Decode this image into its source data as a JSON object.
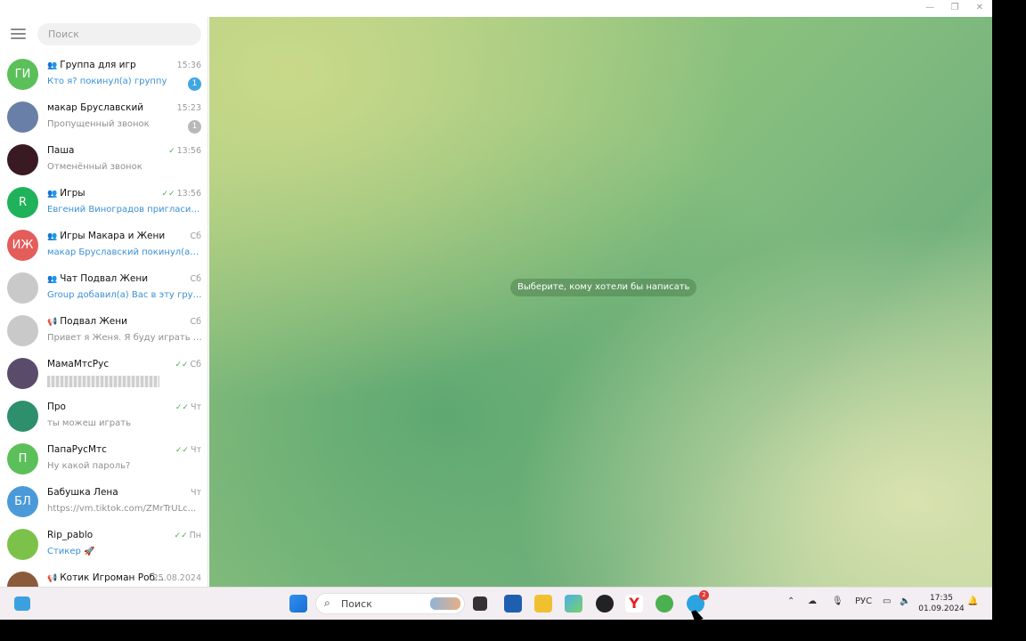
{
  "sidebar": {
    "search_placeholder": "Поиск",
    "chats": [
      {
        "name": "Группа для игр",
        "group": true,
        "channel": false,
        "time": "15:36",
        "preview": "Кто я? покинул(а) группу",
        "preview_blue": true,
        "initials": "ГИ",
        "avatar_color": "#5cc05a",
        "badge": "1",
        "badge_color": "#40a7e3",
        "checks": ""
      },
      {
        "name": "макар Бруславский",
        "group": false,
        "channel": false,
        "time": "15:23",
        "preview": "Пропущенный звонок",
        "preview_blue": false,
        "initials": "",
        "avatar_color": "#6a7fa8",
        "badge": "1",
        "badge_color": "#b8b8b8",
        "checks": ""
      },
      {
        "name": "Паша",
        "group": false,
        "channel": false,
        "time": "13:56",
        "preview": "Отменённый звонок",
        "preview_blue": false,
        "initials": "",
        "avatar_color": "#3a1a22",
        "badge": "",
        "badge_color": "",
        "checks": "✓"
      },
      {
        "name": "Игры",
        "group": true,
        "channel": false,
        "time": "13:56",
        "preview": "Евгений Виноградов пригласил(а) ...",
        "preview_blue": true,
        "initials": "R",
        "avatar_color": "#1fb25a",
        "badge": "",
        "badge_color": "",
        "checks": "✓✓"
      },
      {
        "name": "Игры Макара и Жени",
        "group": true,
        "channel": false,
        "time": "Сб",
        "preview": "макар Бруславский покинул(а) гру...",
        "preview_blue": true,
        "initials": "ИЖ",
        "avatar_color": "#e35d5b",
        "badge": "",
        "badge_color": "",
        "checks": ""
      },
      {
        "name": "Чат Подвал Жени",
        "group": true,
        "channel": false,
        "time": "Сб",
        "preview": "Group добавил(а) Вас в эту группу",
        "preview_blue": true,
        "initials": "",
        "avatar_color": "#c9c9c9",
        "badge": "",
        "badge_color": "",
        "checks": ""
      },
      {
        "name": "Подвал Жени",
        "group": false,
        "channel": true,
        "time": "Сб",
        "preview": "Привет я Женя. Я буду играть с ва...",
        "preview_blue": false,
        "initials": "",
        "avatar_color": "#c9c9c9",
        "badge": "",
        "badge_color": "",
        "checks": ""
      },
      {
        "name": "МамаМтсРус",
        "group": false,
        "channel": false,
        "time": "Сб",
        "preview": "",
        "preview_blue": false,
        "initials": "",
        "avatar_color": "#5b4b6b",
        "badge": "",
        "badge_color": "",
        "checks": "✓✓",
        "preview_blurred": true
      },
      {
        "name": "Про",
        "group": false,
        "channel": false,
        "time": "Чт",
        "preview": "ты можеш играть",
        "preview_blue": false,
        "initials": "",
        "avatar_color": "#2e8f6c",
        "badge": "",
        "badge_color": "",
        "checks": "✓✓"
      },
      {
        "name": "ПапаРусМтс",
        "group": false,
        "channel": false,
        "time": "Чт",
        "preview": "Ну какой пароль?",
        "preview_blue": false,
        "initials": "П",
        "avatar_color": "#5cc05a",
        "badge": "",
        "badge_color": "",
        "checks": "✓✓"
      },
      {
        "name": "Бабушка Лена",
        "group": false,
        "channel": false,
        "time": "Чт",
        "preview": "https://vm.tiktok.com/ZMrTrULc...",
        "preview_blue": false,
        "initials": "БЛ",
        "avatar_color": "#4a9ad9",
        "badge": "",
        "badge_color": "",
        "checks": ""
      },
      {
        "name": "Rip_pablo",
        "group": false,
        "channel": false,
        "time": "Пн",
        "preview": "Стикер 🚀",
        "preview_blue": true,
        "initials": "",
        "avatar_color": "#7cc24a",
        "badge": "",
        "badge_color": "",
        "checks": "✓✓"
      },
      {
        "name": "Котик Игроман Роб...",
        "group": false,
        "channel": true,
        "time": "25.08.2024",
        "preview": "",
        "preview_blue": false,
        "initials": "",
        "avatar_color": "#8a5a3a",
        "badge": "",
        "badge_color": "",
        "checks": ""
      }
    ]
  },
  "main": {
    "hint": "Выберите, кому хотели бы написать"
  },
  "taskbar": {
    "search_label": "Поиск",
    "lang": "РУС",
    "time": "17:35",
    "date": "01.09.2024",
    "telegram_badge": "2"
  },
  "colors": {
    "accent": "#40a7e3",
    "checks": "#4fae4e"
  }
}
